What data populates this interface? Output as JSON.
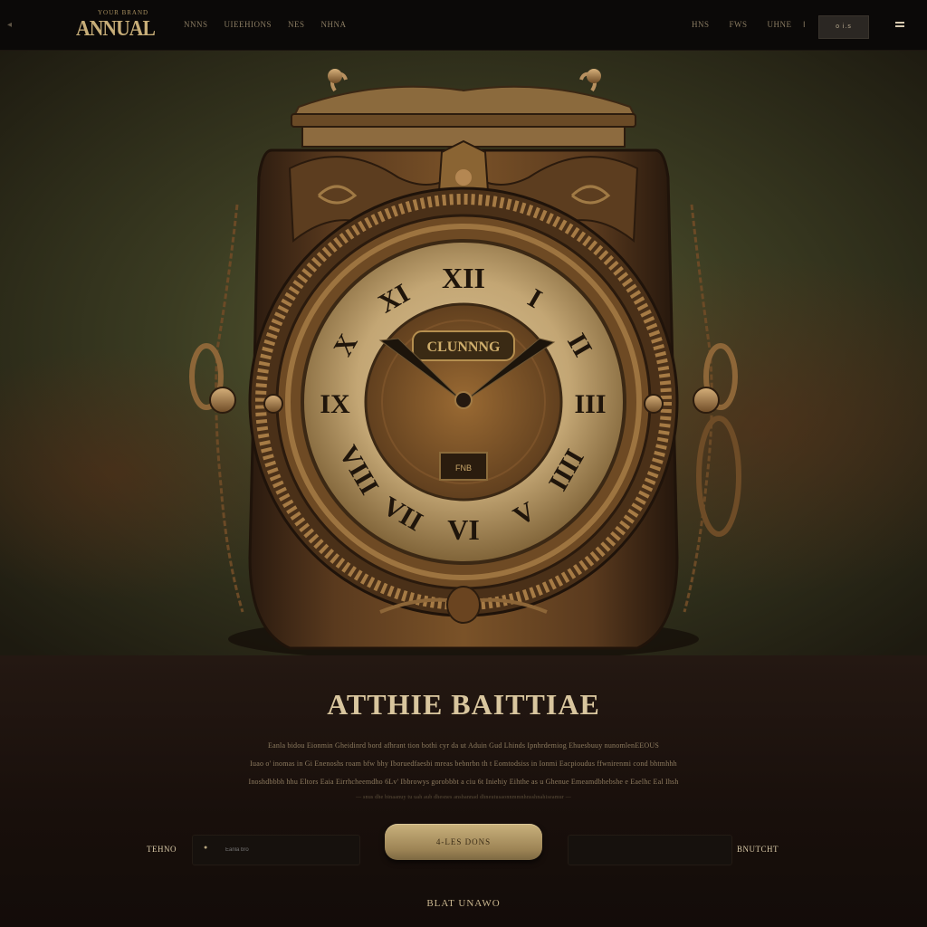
{
  "header": {
    "back_icon": "left-arrow-icon",
    "logo_small": "YOUR BRAND",
    "logo_text": "ANNUAL",
    "nav_left": [
      "NNNS",
      "UIEEHIONS",
      "NES",
      "NHNA"
    ],
    "nav_right": [
      "HNS",
      "FWS",
      "UHNE"
    ],
    "nav_separator": "I",
    "button_label": "o i.s",
    "menu_icon": "hamburger-menu-icon"
  },
  "hero": {
    "clock_plate": "CLUNNNG",
    "clock_window": "FNB"
  },
  "content": {
    "headline": "ATTHIE BAITTIAE",
    "body_lines": [
      "Eanla bidou Eionmin Gheidinrd bord afhrant tion bothi cyr da ut Aduin Gud Lhinds Ipnhrdemiog Ehuesbuuy nunomlenEEOUS",
      "Iuao o' inomas in Gi Enenoshs roam bfw bhy Iboruedfaesbi mreas bebnrbn th t Eomtodsiss in Ionmi Eacpioudus ffwnirenmi cond bhtmhhh",
      "Inoshdbbbh hhu Eltors Eaia Eirrhcheemdho 6Lv' Ibbrowys gorobbbt a ciu 6t Iniehiy Eihthe as u Ghenue Emeamdbhebshe e Eaelhc Eal Ihsh",
      "— snus dhe binaanuy tu uah aub dhesnes ansbannad dhneutusaonnmmnhnsshnahiseamur —"
    ],
    "left_field_label": "TEHNO",
    "left_field_icon": "location-pin-icon",
    "left_field_placeholder": "Eanla bro",
    "cta_label": "4-LES DONS",
    "right_field_placeholder": "",
    "right_field_label": "BNUTCHT",
    "footer_link": "BLAT UNAWO"
  },
  "colors": {
    "accent_gold": "#c9b17c",
    "background_dark": "#0c0907",
    "hero_olive": "#5e6236"
  }
}
